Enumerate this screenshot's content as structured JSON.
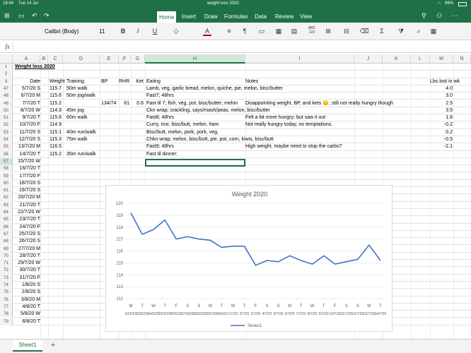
{
  "status": {
    "time": "18:44",
    "date": "Tue 14 Jul",
    "battery": "96%",
    "title": "weight loss 2020"
  },
  "ribbon": {
    "tabs": [
      "Home",
      "Insert",
      "Draw",
      "Formulas",
      "Data",
      "Review",
      "View"
    ],
    "active_tab": "Home"
  },
  "toolbar": {
    "font": "Calibri (Body)",
    "size": "11",
    "bold": "B",
    "italic": "I",
    "underline": "U",
    "font_color": "A",
    "wrap": "¶",
    "sort": "ABC 123",
    "sum": "Σ"
  },
  "formula": {
    "fx": "fx",
    "value": ""
  },
  "columns": [
    "A",
    "B",
    "C",
    "D",
    "E",
    "F",
    "G",
    "H",
    "I",
    "J",
    "K",
    "L",
    "M",
    "N"
  ],
  "rows": [
    {
      "n": "1",
      "a": "Weight loss 2020"
    },
    {
      "n": "2"
    },
    {
      "n": "3",
      "a": "Date",
      "c": "Weight",
      "d": "Training",
      "e": "BP",
      "f": "RHR",
      "g": "Ket",
      "h": "Eating",
      "i": "Notes",
      "m": "Lbs lost in wk"
    },
    {
      "n": "47",
      "a": "5/7/20 S",
      "c": "115.7",
      "d": "50m walk",
      "h": "Lamb, veg, garlic bread, melon, quiche, pie, melon, bisc/butter",
      "m": "4.0"
    },
    {
      "n": "48",
      "a": "6/7/20 M",
      "c": "115.6",
      "d": "50m jog/walk",
      "h": "Fast7; 48hrs",
      "m": "3.0"
    },
    {
      "n": "49",
      "a": "7/7/20 T",
      "c": "115.2",
      "e": "134/74",
      "f": "61",
      "g": "0.6",
      "h": "Fast til 7; fish, veg, pot, bisc/butter; melon",
      "i": "Disappointing weight, BP, and kets 😞; still not really hungry though",
      "m": "2.5"
    },
    {
      "n": "50",
      "a": "8/7/20 W",
      "c": "114.9",
      "d": "45m jog",
      "h": "Ckn wrap; crackling, says/mash/peas, melon, bisc/butter",
      "m": "3.5"
    },
    {
      "n": "51",
      "a": "9/7/20 T",
      "c": "115.6",
      "d": "60m walk",
      "h": "Fast8; 48hrs",
      "i": "Felt a bit more hungry; but saw it out",
      "m": "1.8"
    },
    {
      "n": "52",
      "a": "10/7/20 F",
      "c": "114.9",
      "h": "Curry, rice, bisc/butt, melon, ham",
      "i": "Not really hungry today, no temptations.",
      "m": "-0.2"
    },
    {
      "n": "53",
      "a": "11/7/20 S",
      "c": "115.1",
      "d": "40m run/walk",
      "h": "Bisc/butt, melon, pork, pork, veg,",
      "m": "0.2"
    },
    {
      "n": "54",
      "a": "12/7/20 S",
      "c": "115.3",
      "d": "75m walk",
      "h": "Chkn wrap; melon, bisc/butt, pie, pot, corn, kiwis, bisc/butt",
      "m": "-0.5"
    },
    {
      "n": "55",
      "a": "13/7/20 M",
      "c": "116.5",
      "h": "Fast9; 48hrs",
      "i": "High weight, maybe need to stop the carbs?",
      "m": "-2.1"
    },
    {
      "n": "56",
      "a": "14/7/20 T",
      "c": "115.2",
      "d": "35m run/walk",
      "h": "Fast til dinner;"
    },
    {
      "n": "57",
      "a": "15/7/20 W"
    },
    {
      "n": "58",
      "a": "16/7/20 T"
    },
    {
      "n": "59",
      "a": "17/7/20 F"
    },
    {
      "n": "60",
      "a": "18/7/20 S"
    },
    {
      "n": "61",
      "a": "19/7/20 S"
    },
    {
      "n": "62",
      "a": "20/7/20 M"
    },
    {
      "n": "63",
      "a": "21/7/20 T"
    },
    {
      "n": "64",
      "a": "22/7/20 W"
    },
    {
      "n": "65",
      "a": "23/7/20 T"
    },
    {
      "n": "66",
      "a": "24/7/20 F"
    },
    {
      "n": "67",
      "a": "25/7/20 S"
    },
    {
      "n": "68",
      "a": "26/7/20 S"
    },
    {
      "n": "69",
      "a": "27/7/20 M"
    },
    {
      "n": "70",
      "a": "28/7/20 T"
    },
    {
      "n": "71",
      "a": "29/7/20 W"
    },
    {
      "n": "72",
      "a": "30/7/20 T"
    },
    {
      "n": "73",
      "a": "31/7/20 F"
    },
    {
      "n": "74",
      "a": "1/8/20 S"
    },
    {
      "n": "75",
      "a": "2/8/20 S"
    },
    {
      "n": "76",
      "a": "3/8/20 M"
    },
    {
      "n": "77",
      "a": "4/8/20 T"
    },
    {
      "n": "78",
      "a": "5/8/20 W"
    },
    {
      "n": "79",
      "a": "6/8/20 T"
    }
  ],
  "sheet": {
    "name": "Sheet1",
    "add": "+"
  },
  "chart_data": {
    "type": "line",
    "title": "Weight 2020",
    "x_day_labels": [
      "M",
      "T",
      "W",
      "T",
      "F",
      "S",
      "S",
      "M",
      "T",
      "W",
      "T",
      "F",
      "S",
      "S",
      "M",
      "T",
      "W",
      "T",
      "F",
      "S",
      "S",
      "M",
      "T"
    ],
    "x_date_labels": [
      "22/6/20",
      "23/6/20",
      "24/6/20",
      "25/6/20",
      "26/6/20",
      "27/6/20",
      "28/6/20",
      "29/6/20",
      "30/6/20",
      "1/7/20",
      "2/7/20",
      "3/7/20",
      "4/7/20",
      "5/7/20",
      "6/7/20",
      "7/7/20",
      "8/7/20",
      "9/7/20",
      "10/7/20",
      "11/7/20",
      "12/7/20",
      "13/7/20",
      "14/7/20"
    ],
    "series": [
      {
        "name": "Series1",
        "values": [
          119.2,
          117.4,
          117.8,
          118.6,
          117.0,
          117.2,
          117.0,
          116.9,
          116.3,
          116.4,
          116.4,
          114.8,
          115.2,
          115.1,
          115.6,
          115.2,
          114.9,
          115.6,
          114.9,
          115.1,
          115.3,
          116.5,
          115.2
        ]
      }
    ],
    "ylim": [
      112,
      120
    ],
    "yticks": [
      112,
      113,
      114,
      115,
      116,
      117,
      118,
      119,
      120
    ],
    "grid": true,
    "legend": "bottom",
    "color": "#4472c4"
  }
}
